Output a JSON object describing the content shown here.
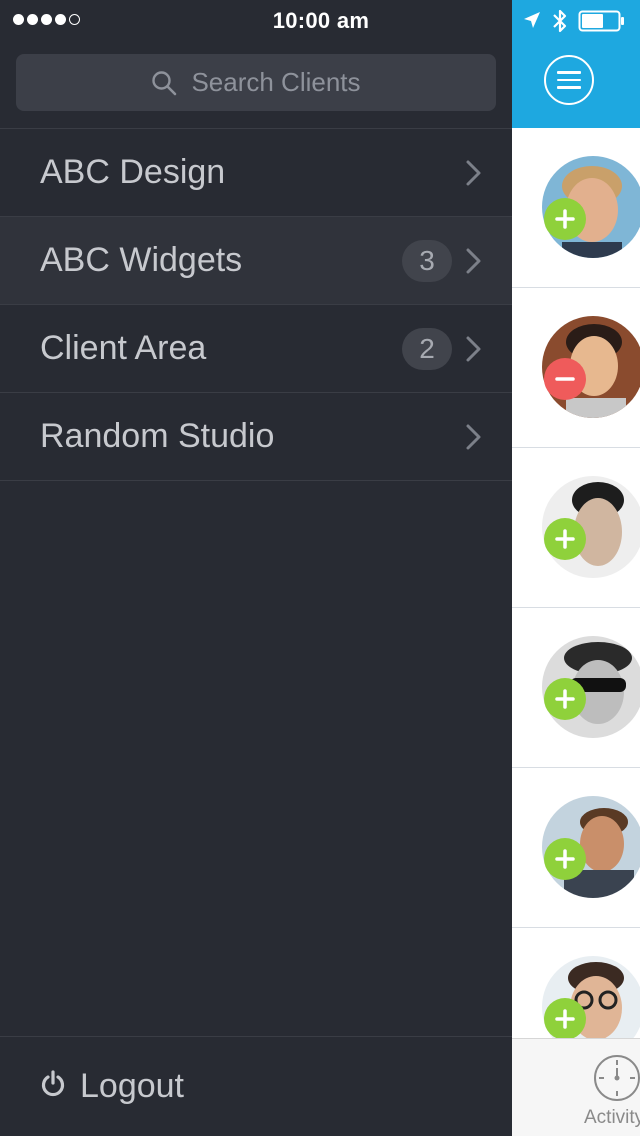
{
  "status_bar": {
    "time": "10:00 am",
    "signal_bars_filled": 4,
    "signal_bars_total": 5,
    "battery_level": 0.6
  },
  "search": {
    "placeholder": "Search Clients"
  },
  "clients": [
    {
      "name": "ABC Design",
      "badge": ""
    },
    {
      "name": "ABC Widgets",
      "badge": "3"
    },
    {
      "name": "Client Area",
      "badge": "2"
    },
    {
      "name": "Random Studio",
      "badge": ""
    }
  ],
  "logout": {
    "label": "Logout"
  },
  "people": [
    {
      "status": "add",
      "icon": "plus-icon"
    },
    {
      "status": "remove",
      "icon": "minus-icon"
    },
    {
      "status": "add",
      "icon": "plus-icon"
    },
    {
      "status": "add",
      "icon": "plus-icon"
    },
    {
      "status": "add",
      "icon": "plus-icon"
    },
    {
      "status": "add",
      "icon": "plus-icon"
    }
  ],
  "tabbar": {
    "activity_label": "Activity"
  },
  "colors": {
    "drawer_bg": "#282b33",
    "header_blue": "#1ea8e0",
    "add_green": "#8fd13b",
    "remove_red": "#ef5b5b"
  }
}
